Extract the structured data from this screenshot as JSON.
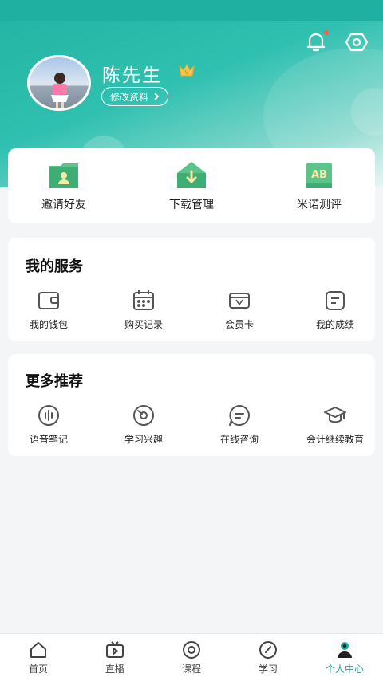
{
  "profile": {
    "name": "陈先生",
    "edit_label": "修改资料",
    "vip_badge": "V"
  },
  "quick_actions": [
    {
      "label": "邀请好友",
      "icon": "user-folder-icon"
    },
    {
      "label": "下载管理",
      "icon": "download-folder-icon"
    },
    {
      "label": "米诺测评",
      "icon": "ab-book-icon"
    }
  ],
  "services": {
    "title": "我的服务",
    "items": [
      {
        "label": "我的钱包",
        "icon": "wallet-icon"
      },
      {
        "label": "购买记录",
        "icon": "calendar-icon"
      },
      {
        "label": "会员卡",
        "icon": "vip-card-icon"
      },
      {
        "label": "我的成绩",
        "icon": "score-icon"
      }
    ]
  },
  "recommend": {
    "title": "更多推荐",
    "items": [
      {
        "label": "语音笔记",
        "icon": "voice-icon"
      },
      {
        "label": "学习兴趣",
        "icon": "interest-icon"
      },
      {
        "label": "在线咨询",
        "icon": "chat-icon"
      },
      {
        "label": "会计继续教育",
        "icon": "graduation-cap-icon"
      }
    ]
  },
  "nav": {
    "items": [
      {
        "label": "首页",
        "icon": "home-icon"
      },
      {
        "label": "直播",
        "icon": "tv-icon"
      },
      {
        "label": "课程",
        "icon": "course-icon"
      },
      {
        "label": "学习",
        "icon": "compass-icon"
      },
      {
        "label": "个人中心",
        "icon": "person-icon"
      }
    ],
    "active": "个人中心"
  },
  "colors": {
    "brand": "#2ab8a8",
    "active_nav": "#1aa89a",
    "notify_dot": "#ff5a4a"
  }
}
